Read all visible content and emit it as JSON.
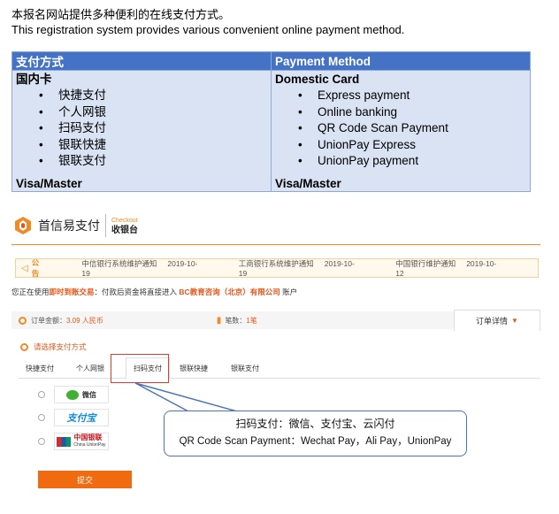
{
  "intro": {
    "line_cn": "本报名网站提供多种便利的在线支付方式。",
    "line_en": "This registration system provides various convenient online payment method."
  },
  "table": {
    "headers": [
      "支付方式",
      "Payment Method"
    ],
    "cn": {
      "title": "国内卡",
      "items": [
        "快捷支付",
        "个人网银",
        "扫码支付",
        "银联快捷",
        "银联支付"
      ],
      "footer": "Visa/Master"
    },
    "en": {
      "title": "Domestic Card",
      "items": [
        "Express payment",
        "Online banking",
        "QR Code Scan Payment",
        "UnionPay Express",
        "UnionPay payment"
      ],
      "footer": "Visa/Master"
    }
  },
  "checkout": {
    "brand_name": "首信易支付",
    "brand_en": "Checkout",
    "brand_cn": "收银台",
    "notice": {
      "tag": "公告",
      "items": [
        {
          "text": "中信银行系统维护通知",
          "date": "2019-10-19"
        },
        {
          "text": "工商银行系统维护通知",
          "date": "2019-10-19"
        },
        {
          "text": "中国银行维护通知",
          "date": "2019-10-12"
        }
      ]
    },
    "using": {
      "prefix": "您正在使用",
      "mode": "即时到账交易",
      "middle": "：付款后资金将直接进入",
      "merchant": "BC教育咨询（北京）有限公司",
      "suffix": "账户"
    },
    "summary": {
      "amount_label": "订单金额：",
      "amount_value": "3.09 人民币",
      "count_label": "笔数：",
      "count_value": "1笔",
      "details": "订单详情",
      "details_arrow": "▼"
    },
    "choose_label": "请选择支付方式",
    "tabs": [
      "快捷支付",
      "个人网银",
      "扫码支付",
      "银联快捷",
      "银联支付"
    ],
    "active_tab": "扫码支付",
    "options": {
      "wechat": "微信",
      "alipay": "支付宝",
      "unionpay_cn": "中国银联",
      "unionpay_en": "China UnionPay"
    },
    "submit": "提交"
  },
  "callout": {
    "line_cn": "扫码支付：微信、支付宝、云闪付",
    "line_en": "QR Code Scan Payment：Wechat Pay，Ali Pay，UnionPay"
  },
  "colors": {
    "header_blue": "#4472c4",
    "cell_blue": "#dae3f3",
    "accent_orange": "#f08a24",
    "highlight_red": "#e23b2e",
    "callout_border": "#4a74b8"
  }
}
